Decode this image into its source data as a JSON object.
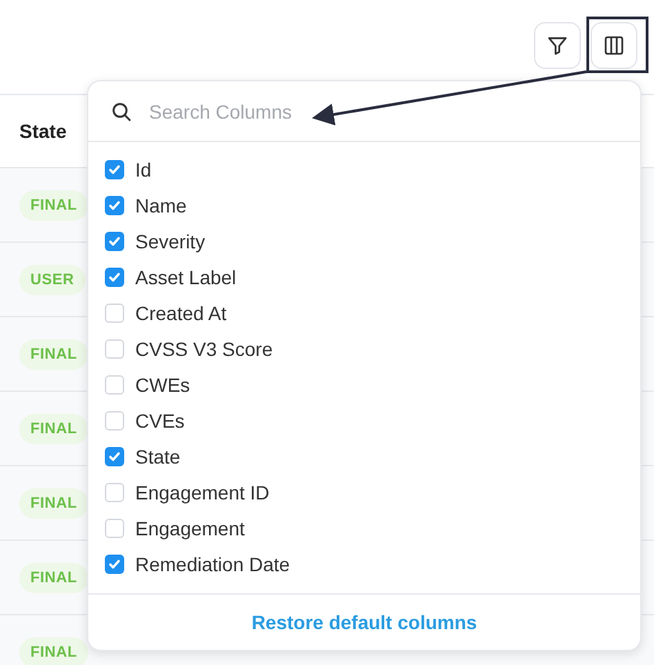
{
  "toolbar": {
    "buttons": [
      {
        "kind": "filter"
      },
      {
        "kind": "columns",
        "highlighted": true
      }
    ]
  },
  "table": {
    "columns": [
      "State"
    ],
    "rows": [
      {
        "state": "FINAL"
      },
      {
        "state": "USER"
      },
      {
        "state": "FINAL"
      },
      {
        "state": "FINAL"
      },
      {
        "state": "FINAL"
      },
      {
        "state": "FINAL"
      },
      {
        "state": "FINAL"
      }
    ]
  },
  "column_picker": {
    "search": {
      "placeholder": "Search Columns"
    },
    "items": [
      {
        "label": "Id",
        "checked": true
      },
      {
        "label": "Name",
        "checked": true
      },
      {
        "label": "Severity",
        "checked": true
      },
      {
        "label": "Asset Label",
        "checked": true
      },
      {
        "label": "Created At",
        "checked": false
      },
      {
        "label": "CVSS V3 Score",
        "checked": false
      },
      {
        "label": "CWEs",
        "checked": false
      },
      {
        "label": "CVEs",
        "checked": false
      },
      {
        "label": "State",
        "checked": true
      },
      {
        "label": "Engagement ID",
        "checked": false
      },
      {
        "label": "Engagement",
        "checked": false
      },
      {
        "label": "Remediation Date",
        "checked": true
      }
    ],
    "footer_action": "Restore default columns"
  }
}
